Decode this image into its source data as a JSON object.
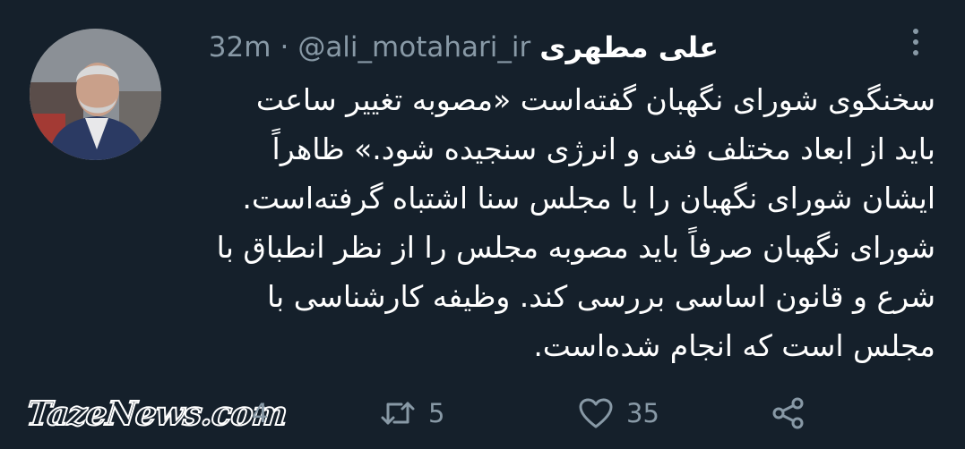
{
  "tweet": {
    "author": {
      "name": "علی مطهری",
      "handle": "@ali_motahari_ir",
      "separator": "·",
      "time": "32m"
    },
    "text_lines": [
      "سخنگوی شورای نگهبان گفته‌است «مصوبه تغییر ساعت",
      "باید از ابعاد مختلف فنی و انرژی سنجیده شود.» ظاهراً",
      "ایشان شورای نگهبان را با مجلس سنا اشتباه گرفته‌است.",
      "شورای نگهبان صرفاً باید مصوبه مجلس را از نظر انطباق با",
      "شرع و قانون اساسی بررسی کند. وظیفه کارشناسی با",
      "مجلس است که انجام شده‌است."
    ],
    "actions": {
      "reply_count": "4",
      "retweet_count": "5",
      "like_count": "35"
    },
    "icons": {
      "more": "more-options-icon",
      "reply": "reply-icon",
      "retweet": "retweet-icon",
      "like": "heart-icon",
      "share": "share-icon"
    }
  },
  "watermark": {
    "text": "TazeNews.com"
  },
  "colors": {
    "background": "#15202b",
    "text": "#ffffff",
    "secondary": "#8899a6"
  }
}
